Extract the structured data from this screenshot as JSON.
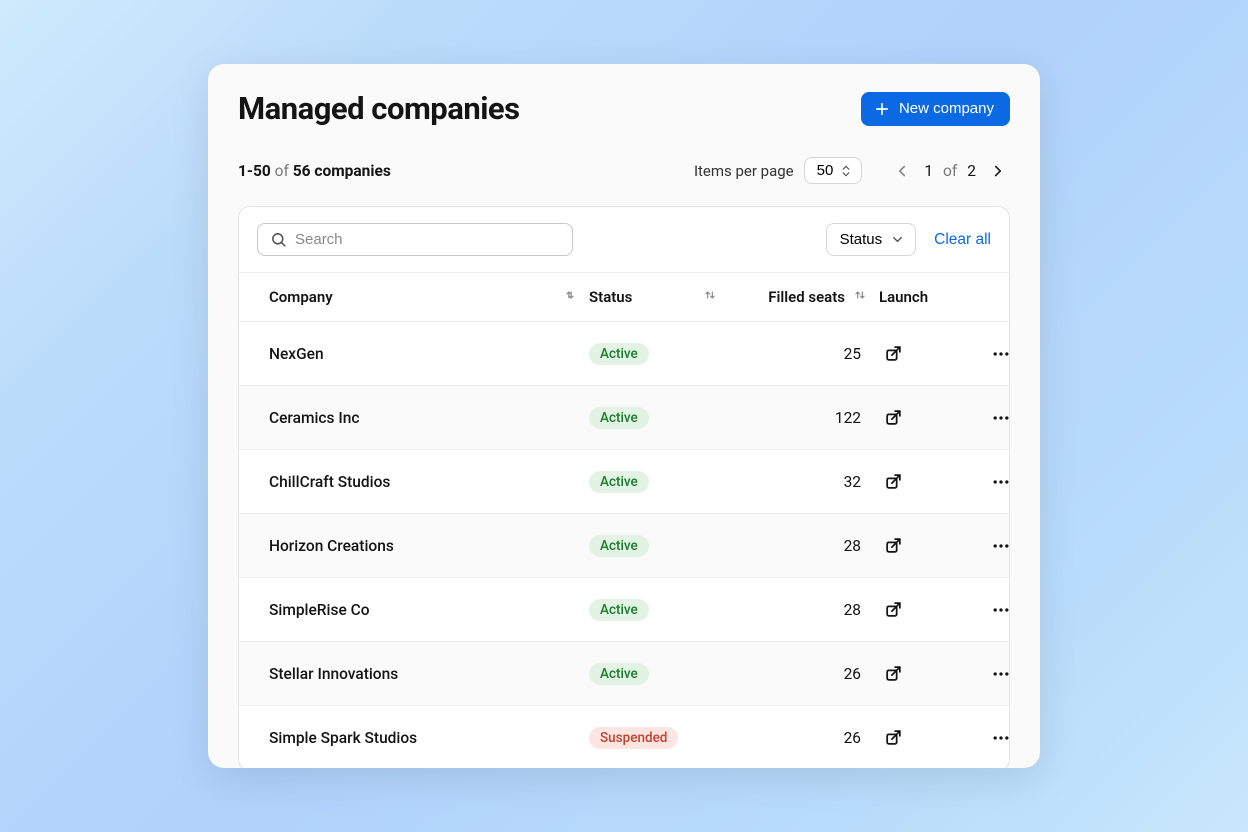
{
  "header": {
    "title": "Managed companies",
    "new_company_label": "New company"
  },
  "summary": {
    "range": "1-50",
    "of_word": "of",
    "total_label": "56 companies"
  },
  "pagination": {
    "items_per_page_label": "Items per page",
    "items_per_page_value": "50",
    "current_page": "1",
    "of_word": "of",
    "total_pages": "2"
  },
  "filters": {
    "search_placeholder": "Search",
    "status_label": "Status",
    "clear_all_label": "Clear all"
  },
  "columns": {
    "company": "Company",
    "status": "Status",
    "filled_seats": "Filled seats",
    "launch": "Launch"
  },
  "status_labels": {
    "active": "Active",
    "suspended": "Suspended"
  },
  "rows": [
    {
      "company": "NexGen",
      "status": "active",
      "seats": "25"
    },
    {
      "company": "Ceramics Inc",
      "status": "active",
      "seats": "122"
    },
    {
      "company": "ChillCraft Studios",
      "status": "active",
      "seats": "32"
    },
    {
      "company": "Horizon Creations",
      "status": "active",
      "seats": "28"
    },
    {
      "company": "SimpleRise Co",
      "status": "active",
      "seats": "28"
    },
    {
      "company": "Stellar Innovations",
      "status": "active",
      "seats": "26"
    },
    {
      "company": "Simple Spark Studios",
      "status": "suspended",
      "seats": "26"
    }
  ]
}
